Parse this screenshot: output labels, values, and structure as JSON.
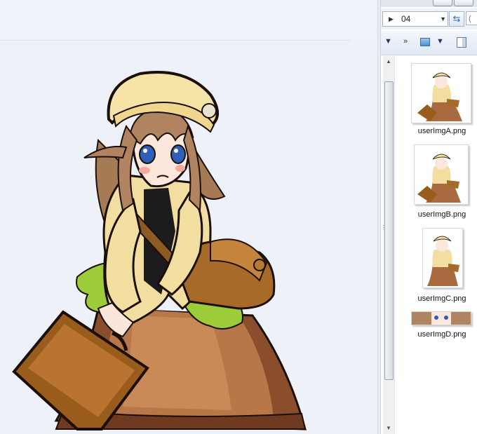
{
  "address": {
    "current_folder": "04"
  },
  "files": [
    {
      "name": "userImgA.png"
    },
    {
      "name": "userImgB.png"
    },
    {
      "name": "userImgC.png"
    },
    {
      "name": "userImgD.png"
    }
  ],
  "colors": {
    "hat": "#f6e3a8",
    "hair": "#b08460",
    "jacket": "#f2dea1",
    "skirt": "#a96a3f",
    "frill": "#9ccc3a",
    "bag": "#a86a28",
    "suitcase": "#9a5c1c",
    "outline": "#1b0f0a"
  },
  "icons": [
    "nav-arrow-icon",
    "dropdown-icon",
    "refresh-icon",
    "search-icon",
    "more-icon",
    "view-icon",
    "preview-pane-icon",
    "scroll-up-icon",
    "scroll-down-icon"
  ]
}
